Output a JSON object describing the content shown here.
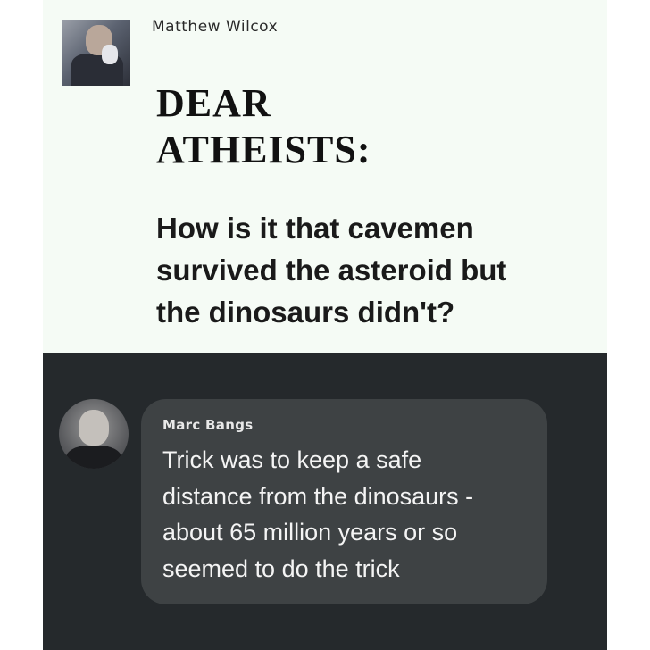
{
  "post": {
    "author": "Matthew Wilcox",
    "headline_lines": [
      "DEAR",
      "ATHEISTS:"
    ],
    "question_lines": [
      "How is it that cavemen",
      "survived the asteroid but",
      "the dinosaurs didn't?"
    ]
  },
  "comment": {
    "author": "Marc Bangs",
    "text_lines": [
      "Trick was to keep a safe",
      "distance from the dinosaurs -",
      "about 65 million years or so",
      "seemed to do the trick"
    ]
  },
  "colors": {
    "post_background": "#f5fbf5",
    "comment_section_background": "#25292c",
    "comment_bubble": "#3e4244"
  }
}
